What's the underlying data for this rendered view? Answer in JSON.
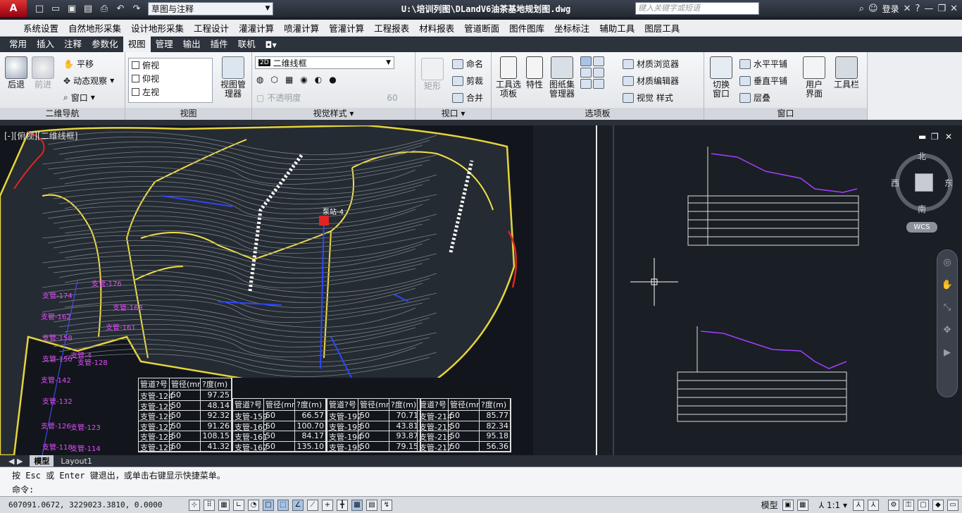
{
  "title_bar": {
    "app_logo": "A",
    "workspace": "草图与注释",
    "doc_title": "U:\\培训列图\\DLandV6油茶基地规划图.dwg",
    "search_placeholder": "键入关键字或短语",
    "login": "登录"
  },
  "menu": [
    "系统设置",
    "自然地形采集",
    "设计地形采集",
    "工程设计",
    "灌灌计算",
    "喷灌计算",
    "管灌计算",
    "工程报表",
    "材料报表",
    "管道断面",
    "图件图库",
    "坐标标注",
    "辅助工具",
    "图层工具"
  ],
  "tabs": [
    "常用",
    "插入",
    "注释",
    "参数化",
    "视图",
    "管理",
    "输出",
    "插件",
    "联机"
  ],
  "active_tab": "视图",
  "ribbon": {
    "nav2d": {
      "title": "二维导航",
      "back": "后退",
      "forward": "前进",
      "pan": "平移",
      "orbit": "动态观察",
      "window": "窗口"
    },
    "views": {
      "title": "视图",
      "items": [
        "俯视",
        "仰视",
        "左视"
      ],
      "manager": "视图管理器"
    },
    "visual": {
      "title": "视觉样式",
      "style": "二维线框",
      "opacity_label": "不透明度",
      "opacity_value": "60"
    },
    "viewport": {
      "title": "视口",
      "rect": "矩形",
      "name": "命名",
      "clip": "剪裁",
      "join": "合并"
    },
    "palettes": {
      "title": "选项板",
      "tool": "工具选项板",
      "props": "特性",
      "sheet": "图纸集管理器",
      "mat_browser": "材质浏览器",
      "mat_editor": "材质编辑器",
      "vstyles": "视觉 样式"
    },
    "window": {
      "title": "窗口",
      "switch": "切换窗口",
      "tile_h": "水平平铺",
      "tile_v": "垂直平铺",
      "cascade": "层叠",
      "ui": "用户界面",
      "toolbar": "工具栏"
    }
  },
  "viewport_label": "[-][俯视][二维线框]",
  "viewcube": {
    "n": "北",
    "s": "南",
    "e": "东",
    "w": "西",
    "wcs": "WCS"
  },
  "table": {
    "headers": [
      "管道?号",
      "管径(mm)",
      "?度(m)"
    ],
    "col1": [
      [
        "支管-124",
        "50",
        "97.25"
      ],
      [
        "支管-125",
        "50",
        "48.14"
      ],
      [
        "支管-126",
        "50",
        "92.32"
      ],
      [
        "支管-127",
        "50",
        "91.26"
      ],
      [
        "支管-128",
        "50",
        "108.15"
      ],
      [
        "支管-129",
        "50",
        "41.32"
      ]
    ],
    "col2": [
      [
        "支管-159",
        "50",
        "66.57"
      ],
      [
        "支管-160",
        "50",
        "100.70"
      ],
      [
        "支管-161",
        "50",
        "84.17"
      ],
      [
        "支管-162",
        "50",
        "135.10"
      ]
    ],
    "col3": [
      [
        "支管-192",
        "50",
        "70.71"
      ],
      [
        "支管-193",
        "50",
        "43.81"
      ],
      [
        "支管-194",
        "50",
        "93.87"
      ],
      [
        "支管-195",
        "50",
        "79.15"
      ]
    ],
    "col4": [
      [
        "支管-214",
        "50",
        "85.77"
      ],
      [
        "支管-215",
        "50",
        "82.34"
      ],
      [
        "支管-216",
        "50",
        "95.18"
      ],
      [
        "支管-217",
        "50",
        "56.36"
      ]
    ]
  },
  "layout_tabs": [
    "模型",
    "Layout1"
  ],
  "command": {
    "line1": "按 Esc 或 Enter 键退出，或单击右键显示快捷菜单。",
    "prompt": "命令:"
  },
  "status": {
    "coords": "607091.0672, 3229023.3810, 0.0000",
    "model": "模型",
    "scale": "1:1"
  },
  "map_labels": [
    "支管-174",
    "支管-162",
    "支管-158",
    "支管-150",
    "支管-142",
    "支管-132",
    "支管-126",
    "支管-123",
    "支管-118",
    "支管-114",
    "支管-128",
    "支管-176",
    "支管-168",
    "支管-161",
    "支管-4"
  ]
}
